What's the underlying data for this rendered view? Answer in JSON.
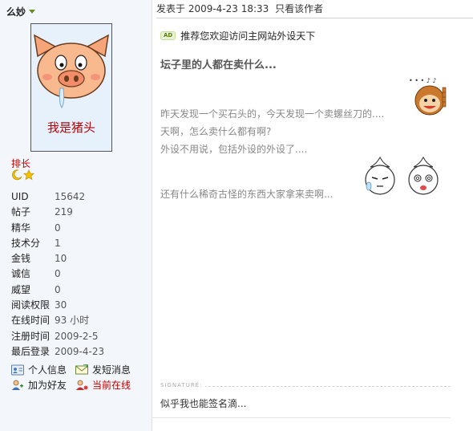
{
  "user": {
    "name": "么妙",
    "avatar_caption": "我是猪头",
    "rank": "排长",
    "stats": [
      {
        "label": "UID",
        "value": "15642"
      },
      {
        "label": "帖子",
        "value": "219"
      },
      {
        "label": "精华",
        "value": "0"
      },
      {
        "label": "技术分",
        "value": "1"
      },
      {
        "label": "金钱",
        "value": "10"
      },
      {
        "label": "诚信",
        "value": "0"
      },
      {
        "label": "威望",
        "value": "0"
      },
      {
        "label": "阅读权限",
        "value": "30"
      },
      {
        "label": "在线时间",
        "value": "93 小时"
      },
      {
        "label": "注册时间",
        "value": "2009-2-5"
      },
      {
        "label": "最后登录",
        "value": "2009-4-23"
      }
    ],
    "actions": {
      "profile": "个人信息",
      "message": "发短消息",
      "add_friend": "加为好友",
      "online": "当前在线"
    }
  },
  "post": {
    "posted_at": "发表于 2009-4-23 18:33",
    "author_only": "只看该作者",
    "ad_badge": "AD",
    "ad_text": "推荐您欢迎访问主网站外设天下",
    "title": "坛子里的人都在卖什么...",
    "body": [
      "昨天发现一个买石头的，今天发现一个卖螺丝刀的....",
      "天啊，怎么卖什么都有啊?",
      "外设不用说，包括外设的外设了....",
      "还有什么稀奇古怪的东西大家拿来卖啊..."
    ],
    "signature_label": "SIGNATURE:",
    "signature": "似乎我也能签名滴..."
  },
  "colors": {
    "rank": "#c00000",
    "caption": "#b4060d",
    "online": "#c00000",
    "body_text": "#888888",
    "sidebar_bg": "#f3f7fb"
  },
  "icons": {
    "caret": "chevron-down-icon",
    "moon": "moon-icon",
    "star": "star-icon",
    "profile": "user-card-icon",
    "message": "envelope-icon",
    "add_friend": "add-user-icon",
    "online": "online-user-icon"
  }
}
